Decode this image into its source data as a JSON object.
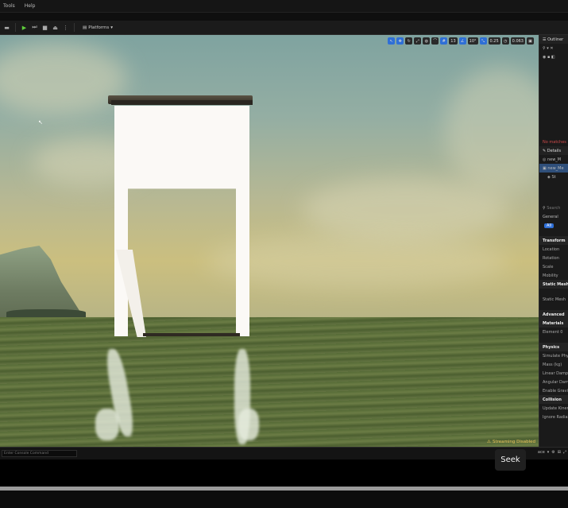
{
  "menubar": {
    "items": [
      "Tools",
      "Help"
    ]
  },
  "toolbar": {
    "platforms_label": "Platforms"
  },
  "viewport": {
    "chips": [
      "13",
      "10°",
      "0.25",
      "0.063"
    ],
    "streaming_label": "Streaming Disabled"
  },
  "outliner": {
    "title": "Outliner",
    "no_match": "No matches",
    "details_title": "Details",
    "selected_item": "new_Me",
    "items": [
      "new_M",
      "St"
    ],
    "search_placeholder": "Search",
    "tabs": [
      "General",
      "All"
    ],
    "sections": {
      "transform": "Transform",
      "static_mesh": "Static Mesh",
      "advanced": "Advanced",
      "materials": "Materials",
      "physics": "Physics",
      "collision": "Collision"
    },
    "fields": [
      "Location",
      "Rotation",
      "Scale",
      "Mobility",
      "Static Mesh",
      "Element 0",
      "Simulate Physics",
      "Mass (kg)",
      "Linear Damping",
      "Angular Damping",
      "Enable Gravity",
      "Update Kinematic",
      "Ignore Radial"
    ]
  },
  "bottombar": {
    "console_placeholder": "Enter Console Command",
    "right_label": "ace"
  },
  "player": {
    "seek_label": "Seek",
    "progress": 1.0
  },
  "colors": {
    "accent": "#2f6fd6",
    "play": "#5fcf3b",
    "warning": "#e7c35a"
  }
}
